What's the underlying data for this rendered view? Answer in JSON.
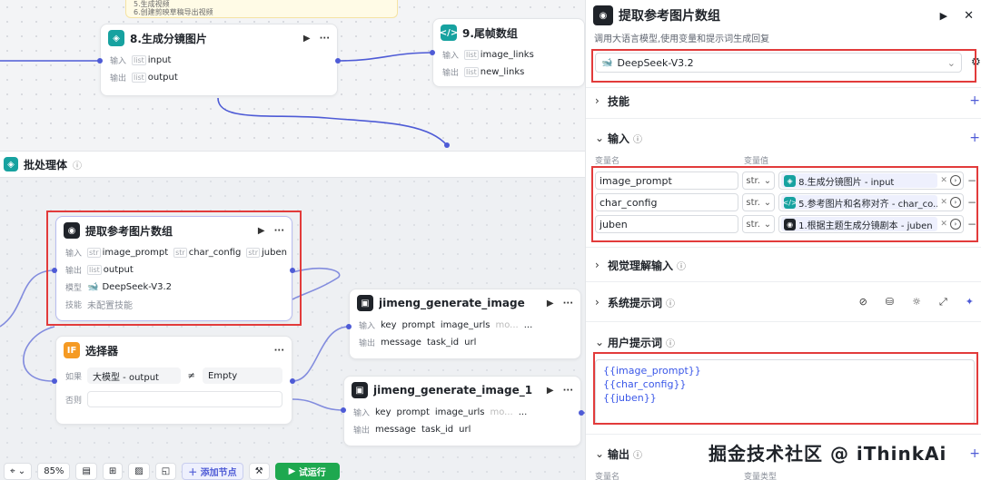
{
  "note": {
    "lines": [
      "5.生成视频",
      "6.创建剪映草稿导出视频"
    ]
  },
  "nodes": {
    "node8": {
      "title": "8.生成分镜图片",
      "input_label": "输入",
      "output_label": "输出",
      "input": "input",
      "output": "output",
      "type": "list"
    },
    "node9": {
      "title": "9.尾帧数组",
      "input_label": "输入",
      "output_label": "输出",
      "input": "image_links",
      "output": "new_links",
      "type": "list"
    },
    "extract": {
      "title": "提取参考图片数组",
      "input_label": "输入",
      "output_label": "输出",
      "model_label": "模型",
      "skill_label": "技能",
      "inputs": [
        "image_prompt",
        "char_config",
        "juben"
      ],
      "output": "output",
      "model": "DeepSeek-V3.2",
      "skill": "未配置技能",
      "type_str": "str",
      "type_list": "list"
    },
    "jimeng1": {
      "title": "jimeng_generate_image",
      "input_label": "输入",
      "output_label": "输出",
      "inputs": [
        "key",
        "prompt",
        "image_urls",
        "mo..."
      ],
      "outputs": [
        "message",
        "task_id",
        "url"
      ],
      "more": "..."
    },
    "jimeng2": {
      "title": "jimeng_generate_image_1",
      "input_label": "输入",
      "output_label": "输出",
      "inputs": [
        "key",
        "prompt",
        "image_urls",
        "mo..."
      ],
      "outputs": [
        "message",
        "task_id",
        "url"
      ],
      "more": "..."
    },
    "selector": {
      "title": "选择器",
      "icon": "IF",
      "if_label": "如果",
      "else_label": "否则",
      "left": "大模型 - output",
      "op": "≠",
      "right": "Empty"
    }
  },
  "group": {
    "title": "批处理体"
  },
  "toolbar": {
    "zoom": "85%",
    "add_node": "添加节点",
    "run": "试运行"
  },
  "panel": {
    "title": "提取参考图片数组",
    "desc": "调用大语言模型,使用变量和提示词生成回复",
    "model": "DeepSeek-V3.2",
    "skills": "技能",
    "input": "输入",
    "col_name": "变量名",
    "col_value": "变量值",
    "vars": [
      {
        "name": "image_prompt",
        "type": "str.",
        "ref": "8.生成分镜图片 - input"
      },
      {
        "name": "char_config",
        "type": "str.",
        "ref": "5.参考图片和名称对齐 - char_co..."
      },
      {
        "name": "juben",
        "type": "str.",
        "ref": "1.根据主题生成分镜剧本 - juben"
      }
    ],
    "vision_input": "视觉理解输入",
    "system_prompt": "系统提示词",
    "user_prompt": "用户提示词",
    "user_prompt_lines": [
      "{{image_prompt}}",
      "{{char_config}}",
      "{{juben}}"
    ],
    "output": "输出",
    "output_col": "变量名",
    "output_col2": "变量类型"
  },
  "watermark": "掘金技术社区 @ iThinkAi",
  "colors": {
    "accent": "#4e5bd6",
    "highlight": "#e23b3b",
    "run": "#1ea84f"
  }
}
